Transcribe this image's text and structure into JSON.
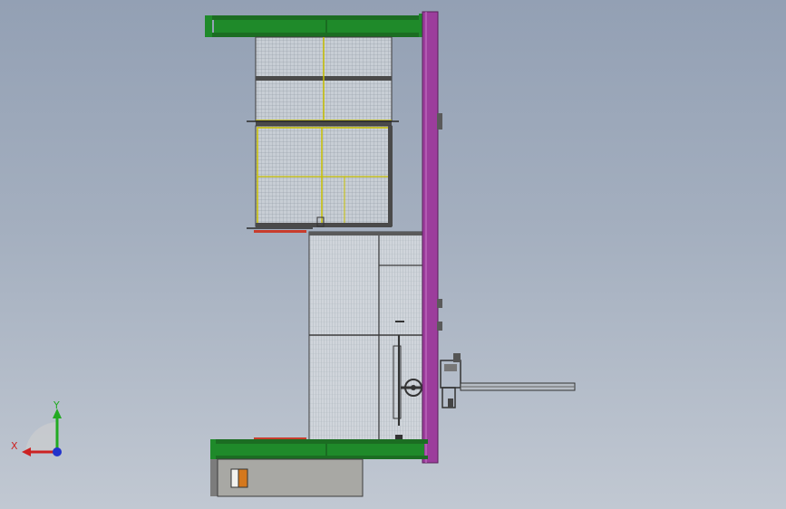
{
  "viewport": {
    "background_top": "#93a0b4",
    "background_bottom": "#c1c8d2"
  },
  "triad": {
    "x_label": "X",
    "y_label": "Y",
    "x_color": "#cc2222",
    "y_color": "#22aa22",
    "z_color": "#2233cc"
  },
  "model": {
    "frame_color": "#1f8a2a",
    "column_color": "#9c3d9c",
    "mesh_color": "#c9cfd6",
    "frame_trim_color": "#c8c000",
    "accent_red": "#c83c2c",
    "accent_orange": "#d4781e",
    "cabinet_color": "#a8a8a4"
  }
}
